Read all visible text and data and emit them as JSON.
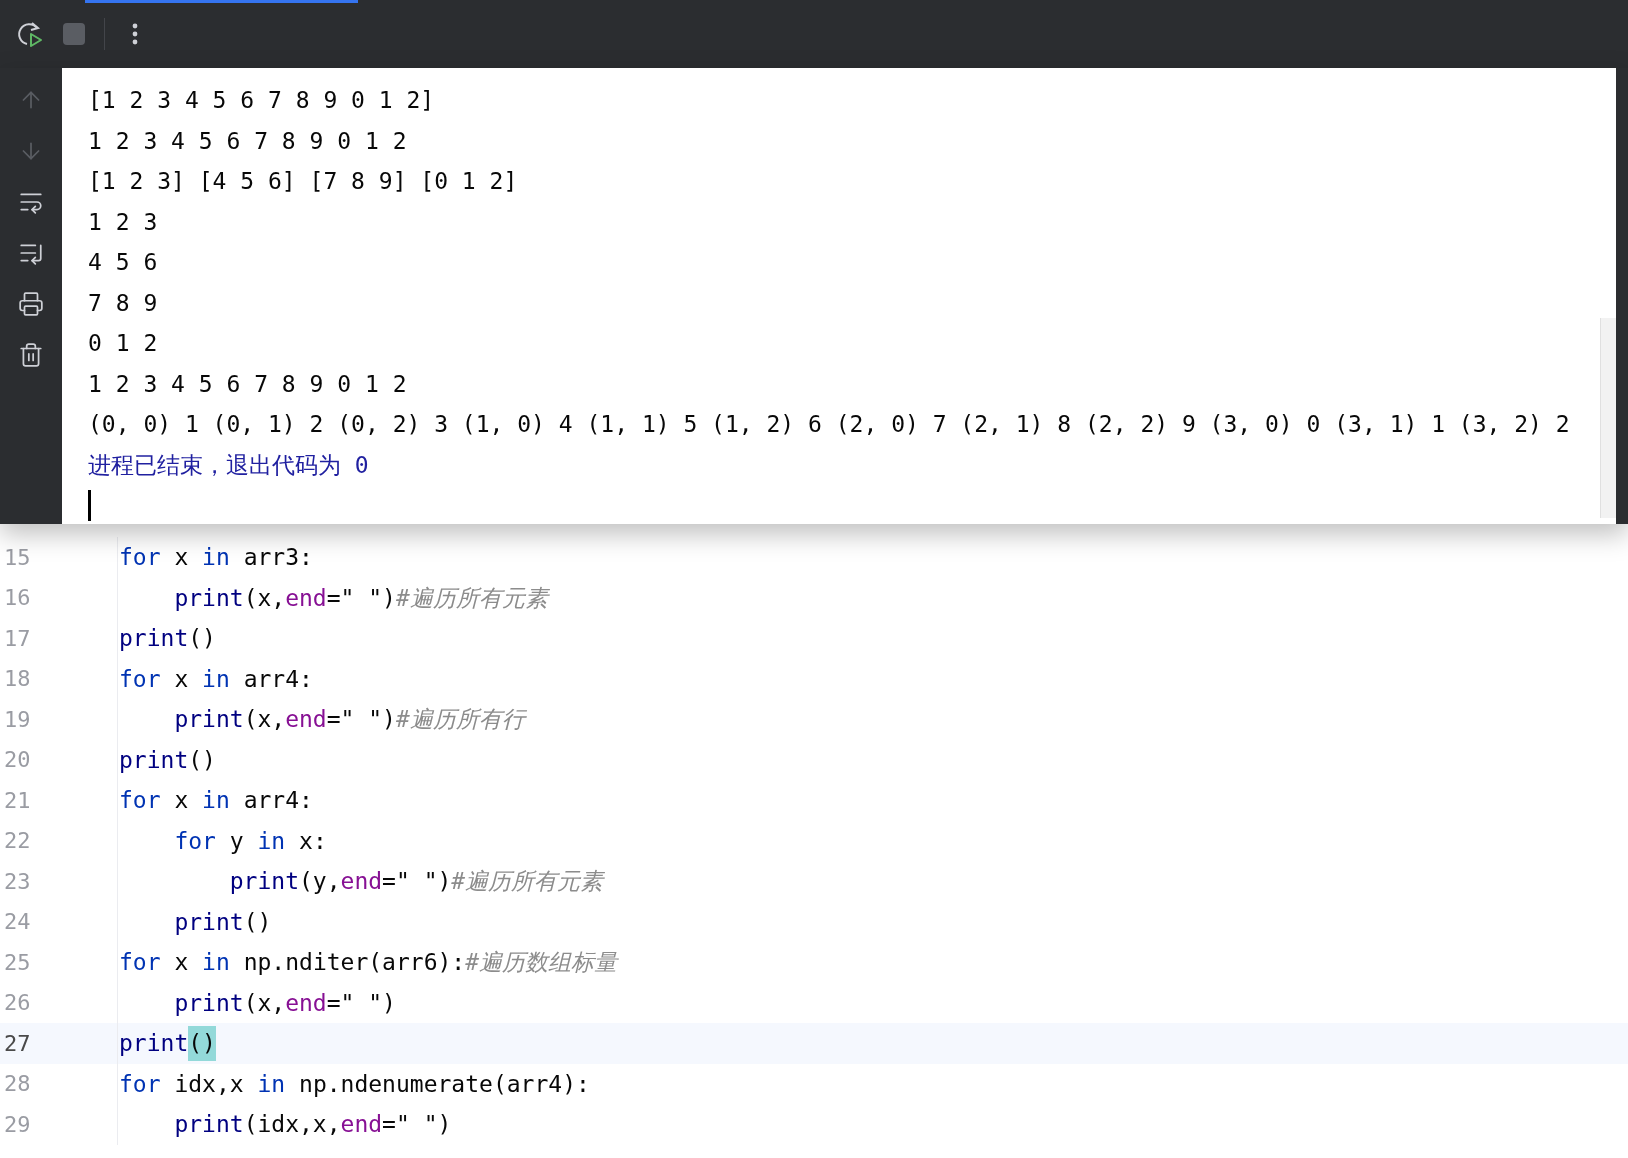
{
  "toolbar": {
    "buttons": [
      {
        "kind": "rerun"
      },
      {
        "kind": "stop",
        "disabled": true
      },
      {
        "kind": "more"
      }
    ]
  },
  "console": {
    "side_buttons": [
      {
        "kind": "up",
        "disabled": true
      },
      {
        "kind": "down",
        "disabled": true
      },
      {
        "kind": "wrap",
        "disabled": false
      },
      {
        "kind": "scroll_end",
        "disabled": false
      },
      {
        "kind": "print",
        "disabled": false
      },
      {
        "kind": "clear",
        "disabled": false
      }
    ],
    "lines": [
      {
        "kind": "output",
        "text": "[1 2 3 4 5 6 7 8 9 0 1 2]"
      },
      {
        "kind": "output",
        "text": "1 2 3 4 5 6 7 8 9 0 1 2"
      },
      {
        "kind": "output",
        "text": "[1 2 3] [4 5 6] [7 8 9] [0 1 2]"
      },
      {
        "kind": "output",
        "text": "1 2 3"
      },
      {
        "kind": "output",
        "text": "4 5 6"
      },
      {
        "kind": "output",
        "text": "7 8 9"
      },
      {
        "kind": "output",
        "text": "0 1 2"
      },
      {
        "kind": "output",
        "text": "1 2 3 4 5 6 7 8 9 0 1 2"
      },
      {
        "kind": "output",
        "text": "(0, 0) 1 (0, 1) 2 (0, 2) 3 (1, 0) 4 (1, 1) 5 (1, 2) 6 (2, 0) 7 (2, 1) 8 (2, 2) 9 (3, 0) 0 (3, 1) 1 (3, 2) 2"
      },
      {
        "kind": "system",
        "text": "进程已结束，退出代码为 0"
      }
    ]
  },
  "editor": {
    "lines": [
      {
        "number": "15",
        "current": false,
        "tokens": [
          {
            "kind": "keyword",
            "text": "for",
            "matched": false
          },
          {
            "kind": "plain",
            "text": " x ",
            "matched": false
          },
          {
            "kind": "keyword",
            "text": "in",
            "matched": false
          },
          {
            "kind": "plain",
            "text": " arr3:",
            "matched": false
          }
        ]
      },
      {
        "number": "16",
        "current": false,
        "tokens": [
          {
            "kind": "builtin",
            "text": "    print",
            "matched": false
          },
          {
            "kind": "plain",
            "text": "(x,",
            "matched": false
          },
          {
            "kind": "param",
            "text": "end",
            "matched": false
          },
          {
            "kind": "plain",
            "text": "=\" \")",
            "matched": false
          },
          {
            "kind": "comment",
            "text": "#遍历所有元素",
            "matched": false
          }
        ]
      },
      {
        "number": "17",
        "current": false,
        "tokens": [
          {
            "kind": "builtin",
            "text": "print",
            "matched": false
          },
          {
            "kind": "plain",
            "text": "()",
            "matched": false
          }
        ]
      },
      {
        "number": "18",
        "current": false,
        "tokens": [
          {
            "kind": "keyword",
            "text": "for",
            "matched": false
          },
          {
            "kind": "plain",
            "text": " x ",
            "matched": false
          },
          {
            "kind": "keyword",
            "text": "in",
            "matched": false
          },
          {
            "kind": "plain",
            "text": " arr4:",
            "matched": false
          }
        ]
      },
      {
        "number": "19",
        "current": false,
        "tokens": [
          {
            "kind": "builtin",
            "text": "    print",
            "matched": false
          },
          {
            "kind": "plain",
            "text": "(x,",
            "matched": false
          },
          {
            "kind": "param",
            "text": "end",
            "matched": false
          },
          {
            "kind": "plain",
            "text": "=\" \")",
            "matched": false
          },
          {
            "kind": "comment",
            "text": "#遍历所有行",
            "matched": false
          }
        ]
      },
      {
        "number": "20",
        "current": false,
        "tokens": [
          {
            "kind": "builtin",
            "text": "print",
            "matched": false
          },
          {
            "kind": "plain",
            "text": "()",
            "matched": false
          }
        ]
      },
      {
        "number": "21",
        "current": false,
        "tokens": [
          {
            "kind": "keyword",
            "text": "for",
            "matched": false
          },
          {
            "kind": "plain",
            "text": " x ",
            "matched": false
          },
          {
            "kind": "keyword",
            "text": "in",
            "matched": false
          },
          {
            "kind": "plain",
            "text": " arr4:",
            "matched": false
          }
        ]
      },
      {
        "number": "22",
        "current": false,
        "tokens": [
          {
            "kind": "keyword",
            "text": "    for",
            "matched": false
          },
          {
            "kind": "plain",
            "text": " y ",
            "matched": false
          },
          {
            "kind": "keyword",
            "text": "in",
            "matched": false
          },
          {
            "kind": "plain",
            "text": " x:",
            "matched": false
          }
        ]
      },
      {
        "number": "23",
        "current": false,
        "tokens": [
          {
            "kind": "builtin",
            "text": "        print",
            "matched": false
          },
          {
            "kind": "plain",
            "text": "(y,",
            "matched": false
          },
          {
            "kind": "param",
            "text": "end",
            "matched": false
          },
          {
            "kind": "plain",
            "text": "=\" \")",
            "matched": false
          },
          {
            "kind": "comment",
            "text": "#遍历所有元素",
            "matched": false
          }
        ]
      },
      {
        "number": "24",
        "current": false,
        "tokens": [
          {
            "kind": "builtin",
            "text": "    print",
            "matched": false
          },
          {
            "kind": "plain",
            "text": "()",
            "matched": false
          }
        ]
      },
      {
        "number": "25",
        "current": false,
        "tokens": [
          {
            "kind": "keyword",
            "text": "for",
            "matched": false
          },
          {
            "kind": "plain",
            "text": " x ",
            "matched": false
          },
          {
            "kind": "keyword",
            "text": "in",
            "matched": false
          },
          {
            "kind": "plain",
            "text": " np.nditer(arr6):",
            "matched": false
          },
          {
            "kind": "comment",
            "text": "#遍历数组标量",
            "matched": false
          }
        ]
      },
      {
        "number": "26",
        "current": false,
        "tokens": [
          {
            "kind": "builtin",
            "text": "    print",
            "matched": false
          },
          {
            "kind": "plain",
            "text": "(x,",
            "matched": false
          },
          {
            "kind": "param",
            "text": "end",
            "matched": false
          },
          {
            "kind": "plain",
            "text": "=\" \")",
            "matched": false
          }
        ]
      },
      {
        "number": "27",
        "current": true,
        "tokens": [
          {
            "kind": "builtin",
            "text": "print",
            "matched": false
          },
          {
            "kind": "plain",
            "text": "()",
            "matched": true
          }
        ]
      },
      {
        "number": "28",
        "current": false,
        "tokens": [
          {
            "kind": "keyword",
            "text": "for",
            "matched": false
          },
          {
            "kind": "plain",
            "text": " idx,x ",
            "matched": false
          },
          {
            "kind": "keyword",
            "text": "in",
            "matched": false
          },
          {
            "kind": "plain",
            "text": " np.ndenumerate(arr4):",
            "matched": false
          }
        ]
      },
      {
        "number": "29",
        "current": false,
        "tokens": [
          {
            "kind": "builtin",
            "text": "    print",
            "matched": false
          },
          {
            "kind": "plain",
            "text": "(idx,x,",
            "matched": false
          },
          {
            "kind": "param",
            "text": "end",
            "matched": false
          },
          {
            "kind": "plain",
            "text": "=\" \")",
            "matched": false
          }
        ]
      }
    ]
  }
}
